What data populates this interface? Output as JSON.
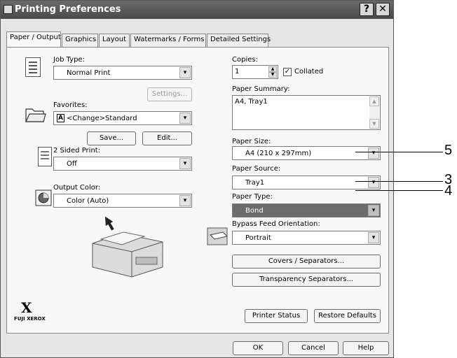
{
  "window": {
    "title": "Printing Preferences",
    "help_btn": "?",
    "close_btn": "✕"
  },
  "tabs": [
    {
      "label": "Paper / Output"
    },
    {
      "label": "Graphics"
    },
    {
      "label": "Layout"
    },
    {
      "label": "Watermarks / Forms"
    },
    {
      "label": "Detailed Settings"
    }
  ],
  "left": {
    "job_type_label": "Job Type:",
    "job_type_value": "Normal Print",
    "settings_button": "Settings...",
    "favorites_label": "Favorites:",
    "favorites_prefix": "A",
    "favorites_value": "<Change>Standard",
    "save_button": "Save...",
    "edit_button": "Edit...",
    "two_sided_label": "2 Sided Print:",
    "two_sided_value": "Off",
    "output_color_label": "Output Color:",
    "output_color_value": "Color (Auto)",
    "brand_logo": "X",
    "brand_text": "FUJI XEROX"
  },
  "right": {
    "copies_label": "Copies:",
    "copies_value": "1",
    "collated_label": "Collated",
    "collated_checked": true,
    "paper_summary_label": "Paper Summary:",
    "paper_summary_value": "A4, Tray1",
    "paper_size_label": "Paper Size:",
    "paper_size_value": "A4 (210 x 297mm)",
    "paper_source_label": "Paper Source:",
    "paper_source_value": "Tray1",
    "paper_type_label": "Paper Type:",
    "paper_type_value": "Bond",
    "bypass_label": "Bypass Feed Orientation:",
    "bypass_value": "Portrait",
    "covers_button": "Covers / Separators...",
    "transparency_button": "Transparency Separators...",
    "printer_status_button": "Printer Status",
    "restore_defaults_button": "Restore Defaults"
  },
  "footer": {
    "ok_button": "OK",
    "cancel_button": "Cancel",
    "help_button": "Help"
  },
  "callouts": {
    "paper_size": "5",
    "paper_source": "3",
    "paper_type": "4"
  }
}
